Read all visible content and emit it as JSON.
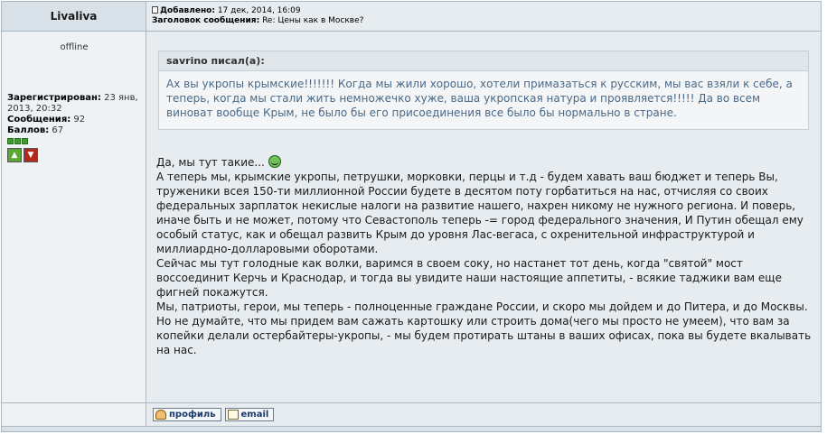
{
  "post": {
    "author": "Livaliva",
    "meta": {
      "added_label": "Добавлено:",
      "added_value": "17 дек, 2014, 16:09",
      "subject_label": "Заголовок сообщения:",
      "subject_value": "Re: Цены как в Москве?"
    }
  },
  "user": {
    "status": "offline",
    "registered_label": "Зарегистрирован:",
    "registered_value": "23 янв, 2013, 20:32",
    "posts_label": "Сообщения:",
    "posts_value": "92",
    "points_label": "Баллов:",
    "points_value": "67"
  },
  "quote": {
    "header": "savrino писал(а):",
    "text": "Ах вы укропы крымские!!!!!!! Когда мы жили хорошо, хотели примазаться к русским, мы вас взяли к себе, а теперь, когда мы стали жить немножечко хуже, ваша укропская натура и проявляется!!!!! Да во всем виноват вообще Крым, не было бы его присоединения все было бы нормально в стране."
  },
  "message": {
    "line1": "Да, мы тут такие...",
    "p1": "А теперь мы, крымские укропы, петрушки, морковки, перцы и т.д - будем хавать ваш бюджет и теперь Вы, труженики всея 150-ти миллионной России будете в десятом поту горбатиться на нас, отчисляя со своих федеральных зарплаток некислые налоги на развитие нашего, нахрен никому не нужного региона. И поверь, иначе быть и не может, потому что Севастополь теперь -= город федерального значения, И Путин обещал ему особый статус, как и обещал развить Крым до уровня Лас-вегаса, с охренительной инфраструктурой и миллиардно-долларовыми оборотами.",
    "p2": "Сейчас мы тут голодные как волки, варимся в своем соку, но настанет тот день, когда \"святой\" мост воссоединит Керчь и Краснодар, и тогда вы увидите наши настоящие аппетиты, - всякие таджики вам еще фигней покажутся.",
    "p3": "Мы, патриоты, герои, мы теперь - полноценные граждане России, и скоро мы дойдем и до Питера, и до Москвы.",
    "p4": "Но не думайте, что мы придем вам сажать картошку или строить дома(чего мы просто не умеем), что вам за копейки делали остербайтеры-укропы, - мы будем протирать штаны в ваших офисах, пока вы будете вкалывать на нас."
  },
  "buttons": {
    "profile": "профиль",
    "email": "email"
  },
  "icons": {
    "post": "post-icon",
    "smile": "smile-icon",
    "vote_up": "thumbs-up-icon",
    "vote_down": "thumbs-down-icon",
    "profile": "profile-icon",
    "email": "envelope-icon"
  },
  "colors": {
    "quote_text": "#4a6a88",
    "link_button_text": "#1a3a6a"
  }
}
